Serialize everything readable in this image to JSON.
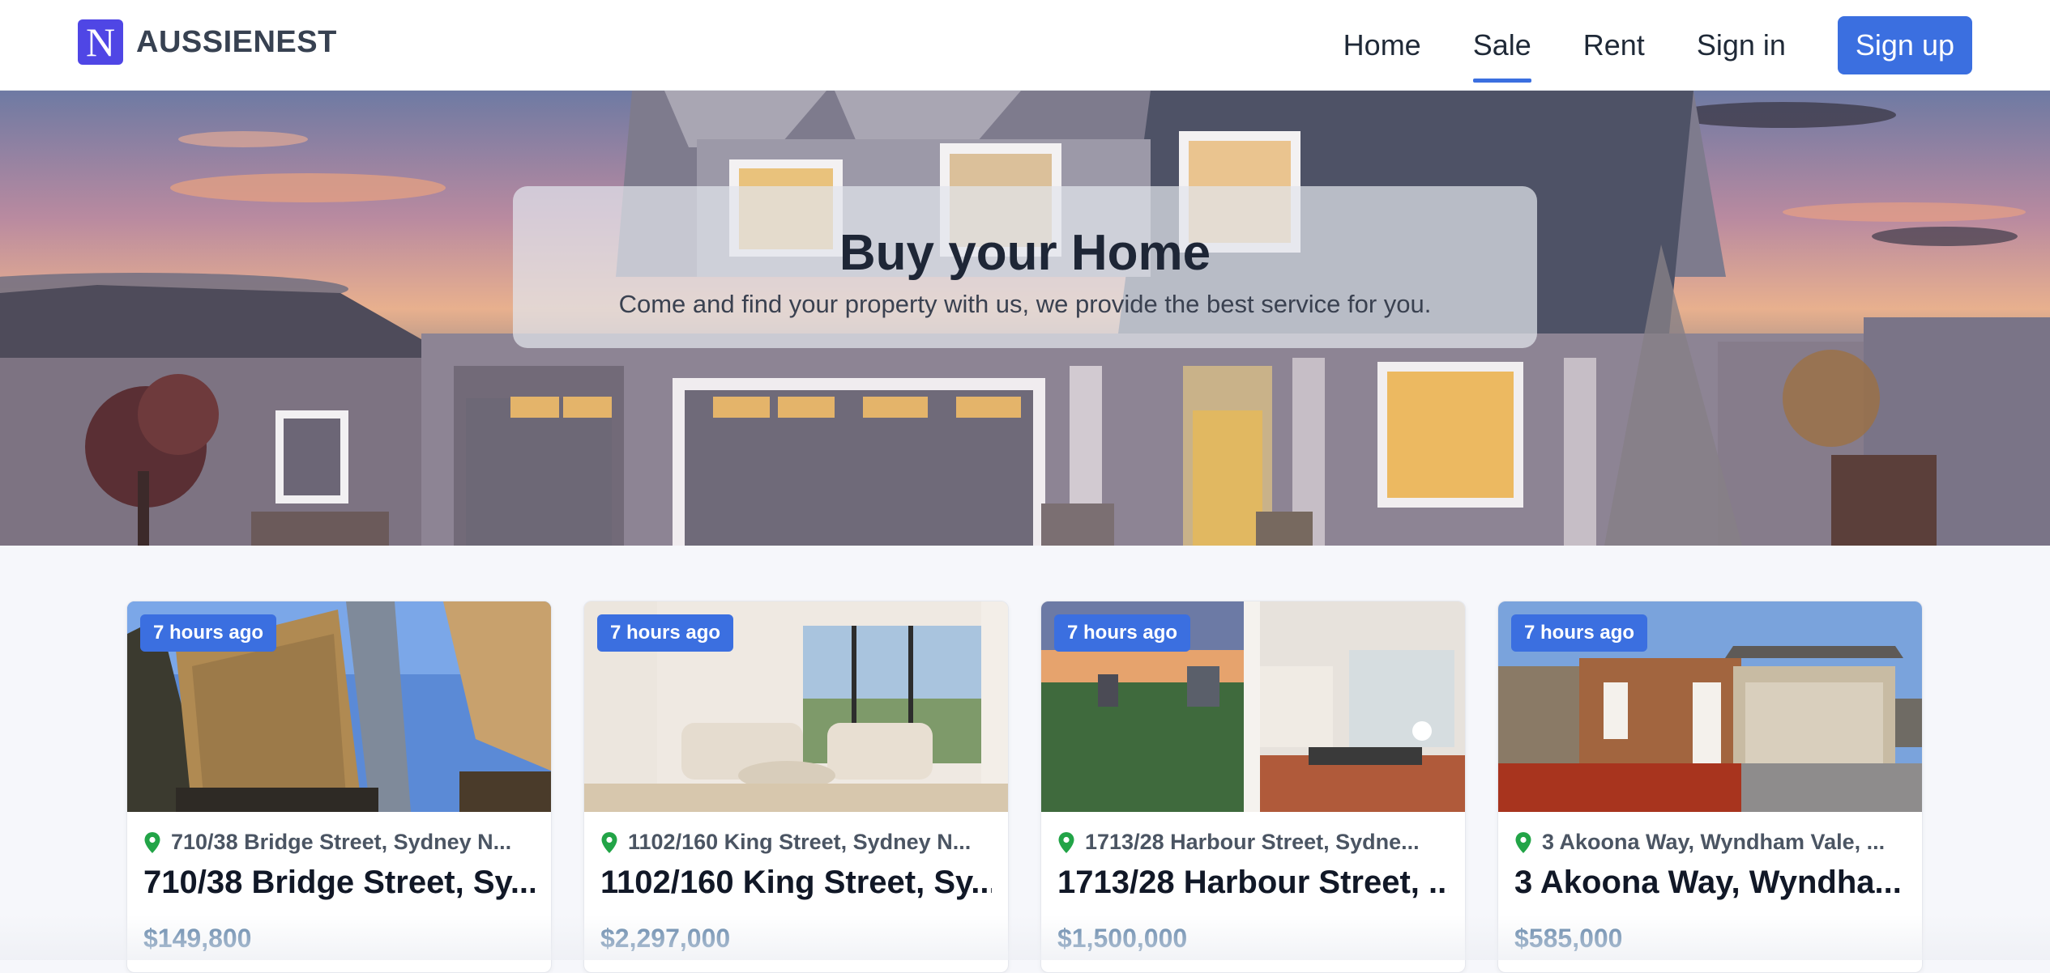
{
  "brand": {
    "logo_letter": "N",
    "name": "AUSSIENEST"
  },
  "nav": {
    "links": [
      {
        "label": "Home",
        "active": false
      },
      {
        "label": "Sale",
        "active": true
      },
      {
        "label": "Rent",
        "active": false
      },
      {
        "label": "Sign in",
        "active": false
      }
    ],
    "signup_label": "Sign up"
  },
  "hero": {
    "title": "Buy your Home",
    "subtitle": "Come and find your property with us, we provide the best service for you."
  },
  "listings": [
    {
      "badge": "7 hours ago",
      "address": "710/38 Bridge Street, Sydney N...",
      "title": "710/38 Bridge Street, Sy...",
      "price": "$149,800"
    },
    {
      "badge": "7 hours ago",
      "address": "1102/160 King Street, Sydney N...",
      "title": "1102/160 King Street, Sy...",
      "price": "$2,297,000"
    },
    {
      "badge": "7 hours ago",
      "address": "1713/28 Harbour Street, Sydne...",
      "title": "1713/28 Harbour Street, ...",
      "price": "$1,500,000"
    },
    {
      "badge": "7 hours ago",
      "address": "3 Akoona Way, Wyndham Vale, ...",
      "title": "3 Akoona Way, Wyndha...",
      "price": "$585,000"
    }
  ],
  "colors": {
    "accent": "#3b6fe0",
    "brand_logo": "#4f46e5",
    "price": "#5a7fa5",
    "pin": "#22a447"
  }
}
